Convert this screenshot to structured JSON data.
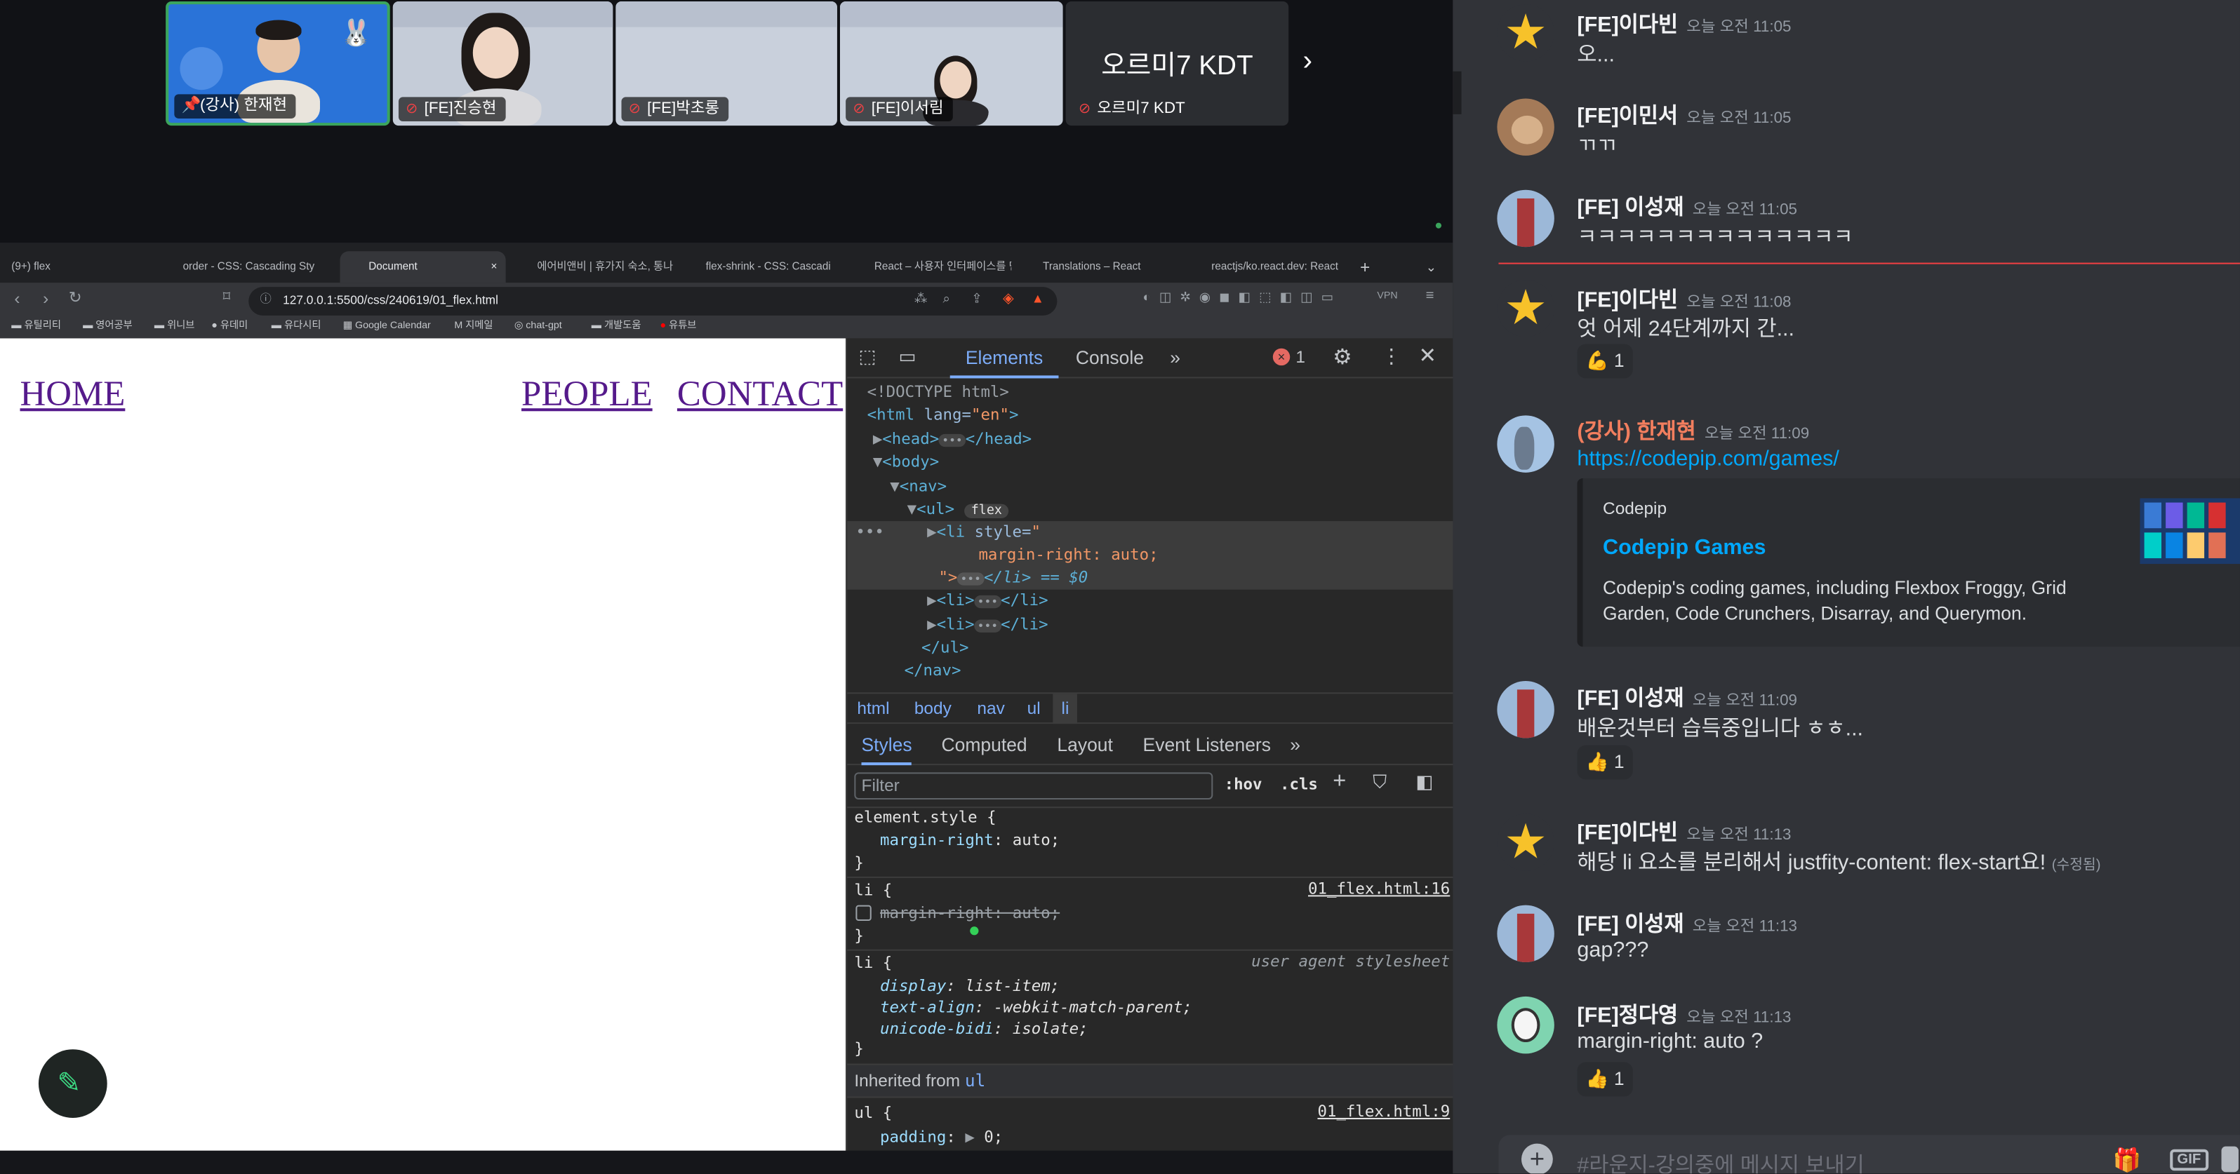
{
  "video": {
    "tiles": [
      {
        "label": "(강사) 한재현"
      },
      {
        "label": "[FE]진승현"
      },
      {
        "label": "[FE]박초롱"
      },
      {
        "label": "[FE]이서림"
      },
      {
        "label": "오르미7 KDT",
        "big": "오르미7 KDT"
      }
    ],
    "next_icon": "chevron-right-icon"
  },
  "browser": {
    "tabs": [
      "(9+) flex",
      "order - CSS: Cascading Sty",
      "Document",
      "에어비앤비 | 휴가지 숙소, 통나",
      "flex-shrink - CSS: Cascadi",
      "React – 사용자 인터페이스를 만",
      "Translations – React",
      "reactjs/ko.react.dev: React"
    ],
    "url": "127.0.0.1:5500/css/240619/01_flex.html",
    "bookmarks": [
      "유틸리티",
      "영어공부",
      "위니브",
      "유데미",
      "유다시티",
      "Google Calendar",
      "지메일",
      "chat-gpt",
      "개발도움",
      "유튜브"
    ],
    "vpn": "VPN"
  },
  "page": {
    "links": [
      "HOME",
      "PEOPLE",
      "CONTACT"
    ]
  },
  "devtools": {
    "tabs": [
      "Elements",
      "Console"
    ],
    "error_count": "1",
    "dom": {
      "doctype": "<!DOCTYPE html>",
      "html_open": "<html",
      "html_attr": " lang=",
      "html_val": "\"en\"",
      "head": "<head>",
      "head_close": "</head>",
      "body": "<body>",
      "nav": "<nav>",
      "ul": "<ul>",
      "flex_badge": "flex",
      "li_open": "<li",
      "li_style_attr": " style=",
      "li_style_val_open": "\"",
      "li_style_value": "margin-right: auto;",
      "li_style_close": "\">",
      "li_close_sel": "</li> == $0",
      "li": "<li>",
      "li_end": "</li>",
      "ul_close": "</ul>",
      "nav_close": "</nav>"
    },
    "breadcrumb": [
      "html",
      "body",
      "nav",
      "ul",
      "li"
    ],
    "style_tabs": [
      "Styles",
      "Computed",
      "Layout",
      "Event Listeners"
    ],
    "filter_placeholder": "Filter",
    "hov": ":hov",
    "cls": ".cls",
    "rules": {
      "element_style": "element.style {",
      "es_prop": "margin-right",
      "es_val": "auto;",
      "li_sel": "li {",
      "li_src": "01_flex.html:16",
      "li_struck": "margin-right: auto;",
      "ua_sel": "li {",
      "ua_src": "user agent stylesheet",
      "ua_p1": "display",
      "ua_v1": "list-item;",
      "ua_p2": "text-align",
      "ua_v2": "-webkit-match-parent;",
      "ua_p3": "unicode-bidi",
      "ua_v3": "isolate;",
      "inherited": "Inherited from",
      "inherited_el": "ul",
      "ul_sel": "ul {",
      "ul_src": "01_flex.html:9",
      "ul_p1": "padding",
      "ul_v1": "0;",
      "close": "}"
    }
  },
  "chat": {
    "messages": [
      {
        "user": "[FE]이다빈",
        "time": "오늘 오전 11:05",
        "text": "오..."
      },
      {
        "user": "[FE]이민서",
        "time": "오늘 오전 11:05",
        "text": "ㄲㄲ"
      },
      {
        "user": "[FE] 이성재",
        "time": "오늘 오전 11:05",
        "text": "ㅋㅋㅋㅋㅋㅋㅋㅋㅋㅋㅋㅋㅋㅋ"
      },
      {
        "user": "[FE]이다빈",
        "time": "오늘 오전 11:08",
        "text": "엇 어제 24단계까지 간...",
        "reaction": "💪 1"
      },
      {
        "user": "(강사) 한재현",
        "time": "오늘 오전 11:09",
        "link": "https://codepip.com/games/",
        "embed": {
          "site": "Codepip",
          "title": "Codepip Games",
          "desc1": "Codepip's coding games, including Flexbox Froggy, Grid",
          "desc2": "Garden, Code Crunchers, Disarray, and Querymon."
        }
      },
      {
        "user": "[FE] 이성재",
        "time": "오늘 오전 11:09",
        "text": "배운것부터 습득중입니다 ㅎㅎ...",
        "reaction": "👍 1"
      },
      {
        "user": "[FE]이다빈",
        "time": "오늘 오전 11:13",
        "text": "해당 li 요소를 분리해서 justfity-content: flex-start요!",
        "edited": "(수정됨)"
      },
      {
        "user": "[FE] 이성재",
        "time": "오늘 오전 11:13",
        "text": "gap???"
      },
      {
        "user": "[FE]정다영",
        "time": "오늘 오전 11:13",
        "text": "margin-right: auto ?",
        "reaction": "👍 1"
      }
    ],
    "input_placeholder": "#라운지-강의중에 메시지 보내기",
    "gif": "GIF",
    "accent": "#f23f43"
  }
}
